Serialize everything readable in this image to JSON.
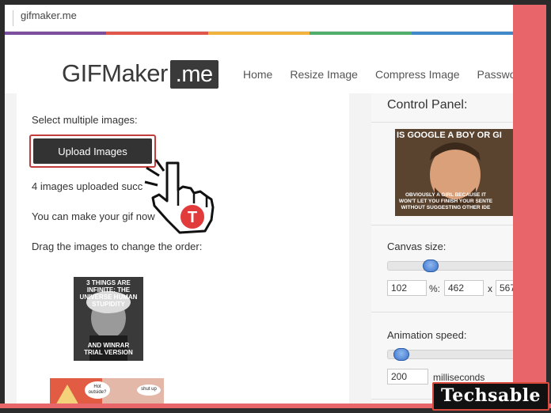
{
  "browser": {
    "url": "gifmaker.me"
  },
  "stripe_colors": [
    "#7c4f9e",
    "#e0564a",
    "#f2b33d",
    "#4fae6a",
    "#3f88c9"
  ],
  "logo": {
    "text": "GIFMaker",
    "suffix": ".me"
  },
  "nav": [
    "Home",
    "Resize Image",
    "Compress Image",
    "Passwo"
  ],
  "left": {
    "select_label": "Select multiple images:",
    "upload_button": "Upload Images",
    "uploaded_msg": "4 images uploaded succ",
    "make_msg": "You can make your gif now",
    "drag_msg": "Drag the images to change the order:",
    "thumb1": {
      "top_text": "3 THINGS ARE INFINITE: THE UNIVERSE HUMAN STUPIDITY",
      "bottom_text": "AND WINRAR TRIAL VERSION"
    },
    "thumb2": {
      "bubble1": "Hot outside?",
      "bubble2": "shut up"
    }
  },
  "control_panel": {
    "title": "Control Panel:",
    "preview": {
      "top_text": "IS GOOGLE A BOY OR GI",
      "bottom_text": "OBVIOUSLY A GIRL BECAUSE IT WON'T LET YOU FINISH YOUR SENTE WITHOUT SUGGESTING OTHER IDE"
    },
    "canvas": {
      "label": "Canvas size:",
      "percent": "102",
      "percent_sep": "%:",
      "width": "462",
      "x": "x",
      "height": "567",
      "slider_level": 0.3
    },
    "animation": {
      "label": "Animation speed:",
      "value": "200",
      "unit": "milliseconds",
      "slider_level": 0.05
    }
  },
  "hand_badge": "T",
  "watermark": "Techsable",
  "colors": {
    "frame": "#e8666a",
    "button": "#333333",
    "highlight": "#c33c3c",
    "slider_knob": "#3a73c9"
  }
}
